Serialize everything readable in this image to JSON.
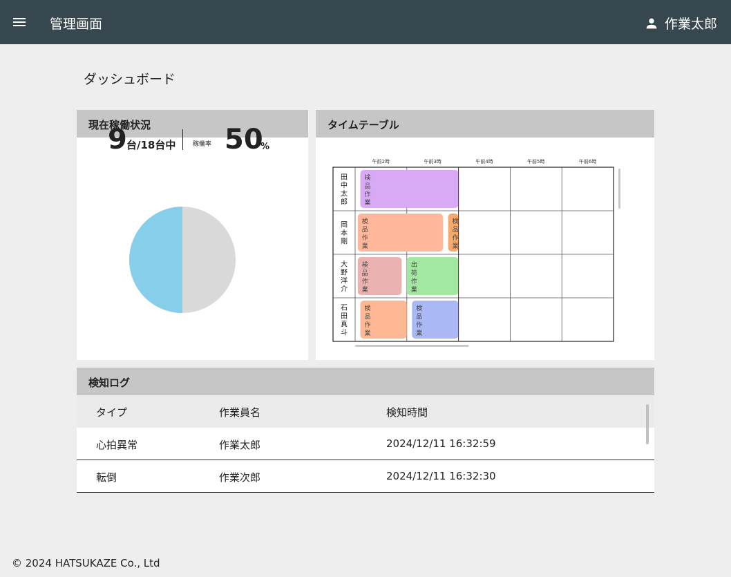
{
  "header": {
    "title": "管理画面",
    "user_name": "作業太郎",
    "menu_icon": "menu-icon",
    "user_icon": "person-icon"
  },
  "page": {
    "title": "ダッシュボード"
  },
  "status": {
    "heading": "現在稼働状況",
    "active_count": "9",
    "count_suffix": "台/18台中",
    "rate_label": "稼働率",
    "rate_value": "50",
    "rate_unit": "%",
    "pie": {
      "active_fraction": 0.5,
      "active_color": "#87ceeb",
      "inactive_color": "#d9d9d9"
    }
  },
  "timetable": {
    "heading": "タイムテーブル",
    "hours": [
      "午前2時",
      "午前3時",
      "午前4時",
      "午前5時",
      "午前6時"
    ],
    "workers": [
      "田中太郎",
      "岡本剛",
      "大野洋介",
      "石田真斗"
    ],
    "now_line_color": "#cc0000",
    "tasks": [
      {
        "worker": 0,
        "label": "検品作業",
        "start": 0.1,
        "end": 2.0,
        "color": "#d8a9f5"
      },
      {
        "worker": 1,
        "label": "検品作業",
        "start": 0.05,
        "end": 1.7,
        "color": "#ffb89c"
      },
      {
        "worker": 1,
        "label": "検品作業",
        "start": 1.8,
        "end": 2.0,
        "color": "#f6a96b"
      },
      {
        "worker": 2,
        "label": "検品作業",
        "start": 0.05,
        "end": 0.9,
        "color": "#ebb2b2"
      },
      {
        "worker": 2,
        "label": "出荷作業",
        "start": 1.0,
        "end": 2.0,
        "color": "#a3e8a1"
      },
      {
        "worker": 3,
        "label": "検品作業",
        "start": 0.1,
        "end": 1.0,
        "color": "#ffb894"
      },
      {
        "worker": 3,
        "label": "検品作業",
        "start": 1.1,
        "end": 2.0,
        "color": "#aab8f5"
      }
    ]
  },
  "log": {
    "heading": "検知ログ",
    "columns": [
      "タイプ",
      "作業員名",
      "検知時間"
    ],
    "rows": [
      [
        "心拍異常",
        "作業太郎",
        "2024/12/11 16:32:59"
      ],
      [
        "転倒",
        "作業次郎",
        "2024/12/11 16:32:30"
      ]
    ]
  },
  "footer": {
    "copyright": "© 2024 HATSUKAZE Co., Ltd"
  }
}
